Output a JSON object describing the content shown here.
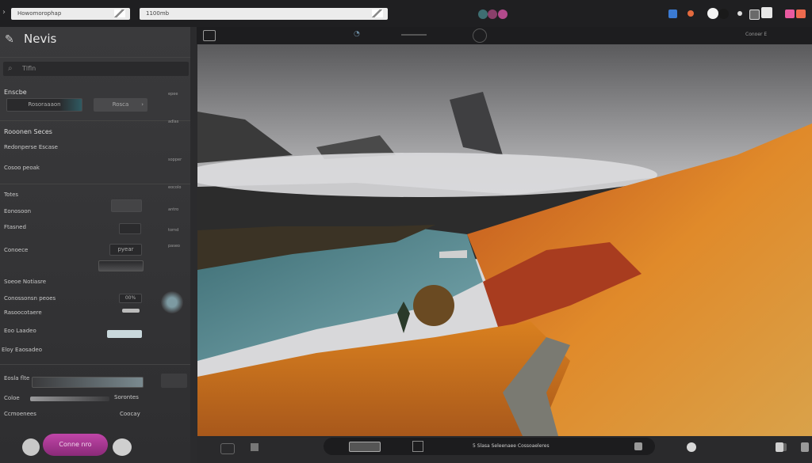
{
  "topbar": {
    "address_1": "Howomorophap",
    "address_2": "1100mb"
  },
  "sidebar": {
    "title": "Nevis",
    "search_placeholder": "Tlfln",
    "section_1": "Enscbe",
    "field_1": "Rosoraaaon",
    "field_1b": "Rosca",
    "section_2": "Rooonen Seces",
    "row_1": "Redonperse Escase",
    "row_2": "Cosoo peoak",
    "section_3": "Totes",
    "row_3": "Eonosoon",
    "row_4": "Ftasned",
    "row_5": "Conoece",
    "field_5": "pyear",
    "section_4": "Soeoe Notiasre",
    "row_6": "Conossonsn peoes",
    "row_6_val": "00%",
    "row_7": "Rasoocotaere",
    "row_8": "Eoo Laadeo",
    "section_5": "Eloy Eaosadeo",
    "row_9": "Eosla flte",
    "row_10": "Coloe",
    "row_10_val": "Sorontes",
    "row_11": "Ccmoenees",
    "row_11_val": "Coocay",
    "primary_button": "Conne nro",
    "right_labels": [
      "epee",
      "adlas",
      "sopper",
      "eocolo",
      "antro",
      "tornd",
      "paseo"
    ]
  },
  "canvas": {
    "header_right": "Conoer E"
  },
  "footer": {
    "caption": "5 Slasa Seleenaee Cossoaeleres"
  },
  "colors": {
    "accent": "#b33d9e",
    "sidebar_bg": "#363638",
    "canvas_bg": "#1d1d1f"
  }
}
